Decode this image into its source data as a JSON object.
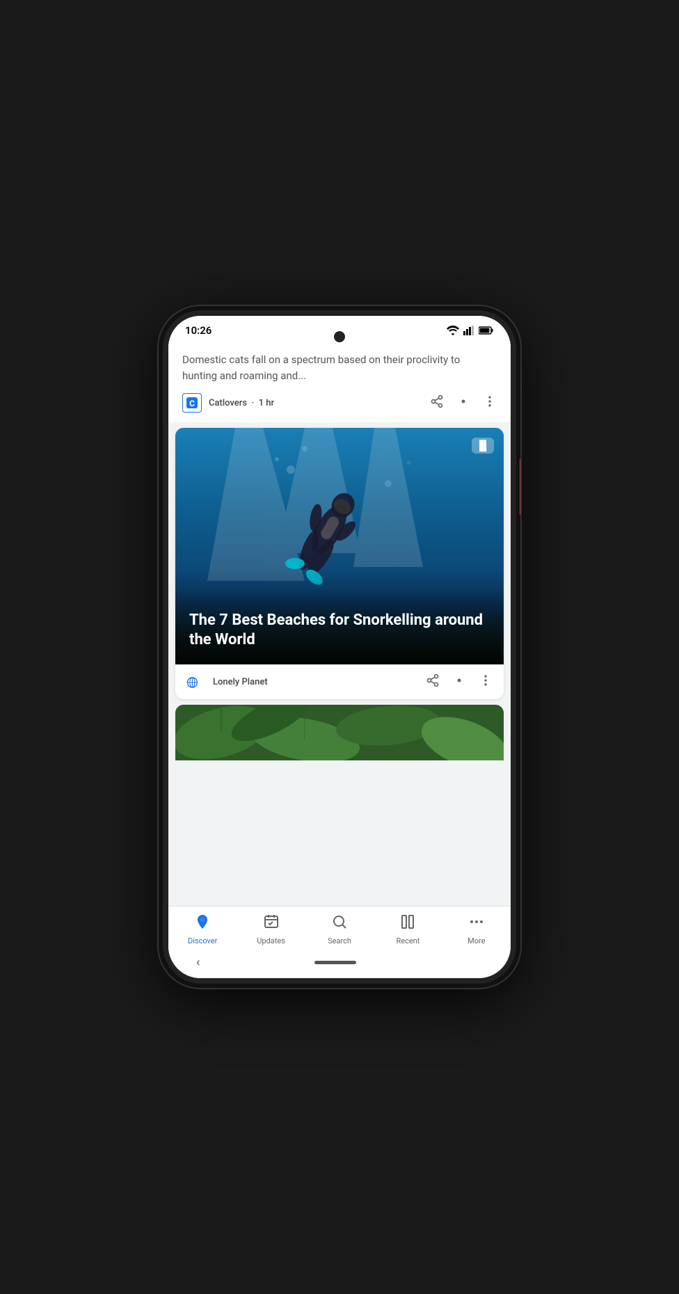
{
  "statusBar": {
    "time": "10:26"
  },
  "cards": [
    {
      "id": "catlovers-card",
      "description": "Domestic cats fall on a spectrum based on their proclivity to hunting and roaming and...",
      "source": "Catlovers",
      "timeAgo": "1 hr"
    },
    {
      "id": "snorkelling-card",
      "imageAlt": "Snorkeller diving underwater",
      "title": "The 7 Best Beaches for Snorkelling around the World",
      "source": "Lonely Planet"
    }
  ],
  "bottomNav": {
    "items": [
      {
        "id": "discover",
        "label": "Discover",
        "active": true
      },
      {
        "id": "updates",
        "label": "Updates",
        "active": false
      },
      {
        "id": "search",
        "label": "Search",
        "active": false
      },
      {
        "id": "recent",
        "label": "Recent",
        "active": false
      },
      {
        "id": "more",
        "label": "More",
        "active": false
      }
    ]
  },
  "colors": {
    "active": "#1a73e8",
    "inactive": "#666666"
  }
}
